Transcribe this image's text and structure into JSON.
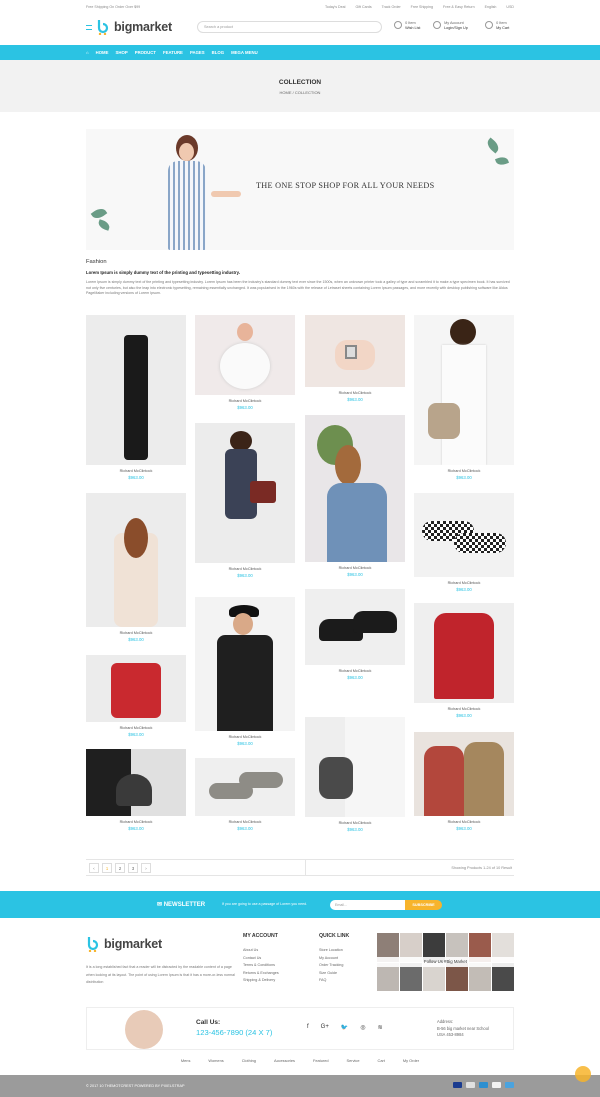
{
  "topbar": {
    "promo": "Free Shipping On Order Over $99",
    "links": [
      "Today's Deal",
      "Gift Cards",
      "Track Order",
      "Free Shipping",
      "Free & Easy Return",
      "English",
      "USD"
    ]
  },
  "header": {
    "logo": "bigmarket",
    "search_placeholder": "Search a product",
    "wishlist_count": "0 Item",
    "wishlist_label": "Wish List",
    "account_label": "My Account",
    "account_action": "Login/Sign Up",
    "cart_count": "0 Item",
    "cart_label": "My Cart"
  },
  "nav": {
    "items": [
      "HOME",
      "SHOP",
      "PRODUCT",
      "FEATURE",
      "PAGES",
      "BLOG",
      "MEGA MENU"
    ]
  },
  "pagehead": {
    "title": "COLLECTION",
    "breadcrumb": "HOME / COLLECTION"
  },
  "banner": {
    "text": "THE ONE STOP SHOP FOR ALL YOUR NEEDS"
  },
  "intro": {
    "heading": "Fashion",
    "subheading": "Lorem Ipsum is simply dummy text of the printing and typesetting industry.",
    "paragraph": "Lorem Ipsum is simply dummy text of the printing and typesetting industry. Lorem Ipsum has been the industry's standard dummy text ever since the 1500s, when an unknown printer took a galley of type and scrambled it to make a type specimen book. It has survived not only five centuries, but also the leap into electronic typesetting, remaining essentially unchanged. It was popularised in the 1960s with the release of Letraset sheets containing Lorem Ipsum passages, and more recently with desktop publishing software like Aldus PageMaker including versions of Lorem Ipsum."
  },
  "products": [
    {
      "name": "Richard McClintock",
      "price": "$963.00",
      "color": "#1a1a1a"
    },
    {
      "name": "Richard McClintock",
      "price": "$963.00",
      "color": "#f2eeee"
    },
    {
      "name": "Richard McClintock",
      "price": "$963.00",
      "color": "#efe6e2"
    },
    {
      "name": "Richard McClintock",
      "price": "$963.00",
      "color": "#b8a48b"
    },
    {
      "name": "Richard McClintock",
      "price": "$963.00",
      "color": "#f0e2d6"
    },
    {
      "name": "Richard McClintock",
      "price": "$963.00",
      "color": "#3b4256"
    },
    {
      "name": "Richard McClintock",
      "price": "$963.00",
      "color": "#6f91b8"
    },
    {
      "name": "Richard McClintock",
      "price": "$963.00",
      "color": "#333333"
    },
    {
      "name": "Richard McClintock",
      "price": "$963.00",
      "color": "#c9292f"
    },
    {
      "name": "Richard McClintock",
      "price": "$963.00",
      "color": "#1f1f1f"
    },
    {
      "name": "Richard McClintock",
      "price": "$963.00",
      "color": "#1b1b1b"
    },
    {
      "name": "Richard McClintock",
      "price": "$963.00",
      "color": "#c0242c"
    },
    {
      "name": "Richard McClintock",
      "price": "$963.00",
      "color": "#3a3a3a"
    },
    {
      "name": "Richard McClintock",
      "price": "$963.00",
      "color": "#8e8c86"
    },
    {
      "name": "Richard McClintock",
      "price": "$963.00",
      "color": "#4a4a4a"
    },
    {
      "name": "Richard McClintock",
      "price": "$963.00",
      "color": "#b3473c"
    }
  ],
  "pager": {
    "pages": [
      "1",
      "2",
      "3"
    ],
    "prev": "‹",
    "next": "›",
    "info": "Showing Products 1-24 of 10 Result"
  },
  "newsletter": {
    "title": "NEWSLETTER",
    "description": "If you are going to use a passage of Lorem you need.",
    "placeholder": "Email...",
    "button": "SUBSCRIBE"
  },
  "footer": {
    "logo": "bigmarket",
    "description": "It is a long established fact that a reader will be distracted by the readable content of a page when looking at its layout. The point of using Lorem Ipsum is that it has a more-or-less normal distribution",
    "account_title": "MY ACCOUNT",
    "account_links": [
      "About Us",
      "Contact Us",
      "Terms & Conditions",
      "Returns & Exchanges",
      "Shipping & Delivery"
    ],
    "quick_title": "QUICK LINK",
    "quick_links": [
      "Store Location",
      "My Account",
      "Order Tracking",
      "Size Guide",
      "FAQ"
    ],
    "instagram_label": "Follow Us #Big Market",
    "call_label": "Call Us:",
    "call_number": "123-456-7890 (24 X 7)",
    "address_label": "Address:",
    "address_lines": [
      "B-56 big market near School",
      "USA 453-8984"
    ],
    "bottom_links": [
      "Mens",
      "Womens",
      "Clothing",
      "Accessories",
      "Featured",
      "Service",
      "Cart",
      "My Order"
    ],
    "copyright": "© 2017 10 THEMOTCREST POWERED BY PIXELSTRAP"
  },
  "colors": {
    "accent": "#2bc3e3",
    "highlight": "#f7b42c"
  }
}
